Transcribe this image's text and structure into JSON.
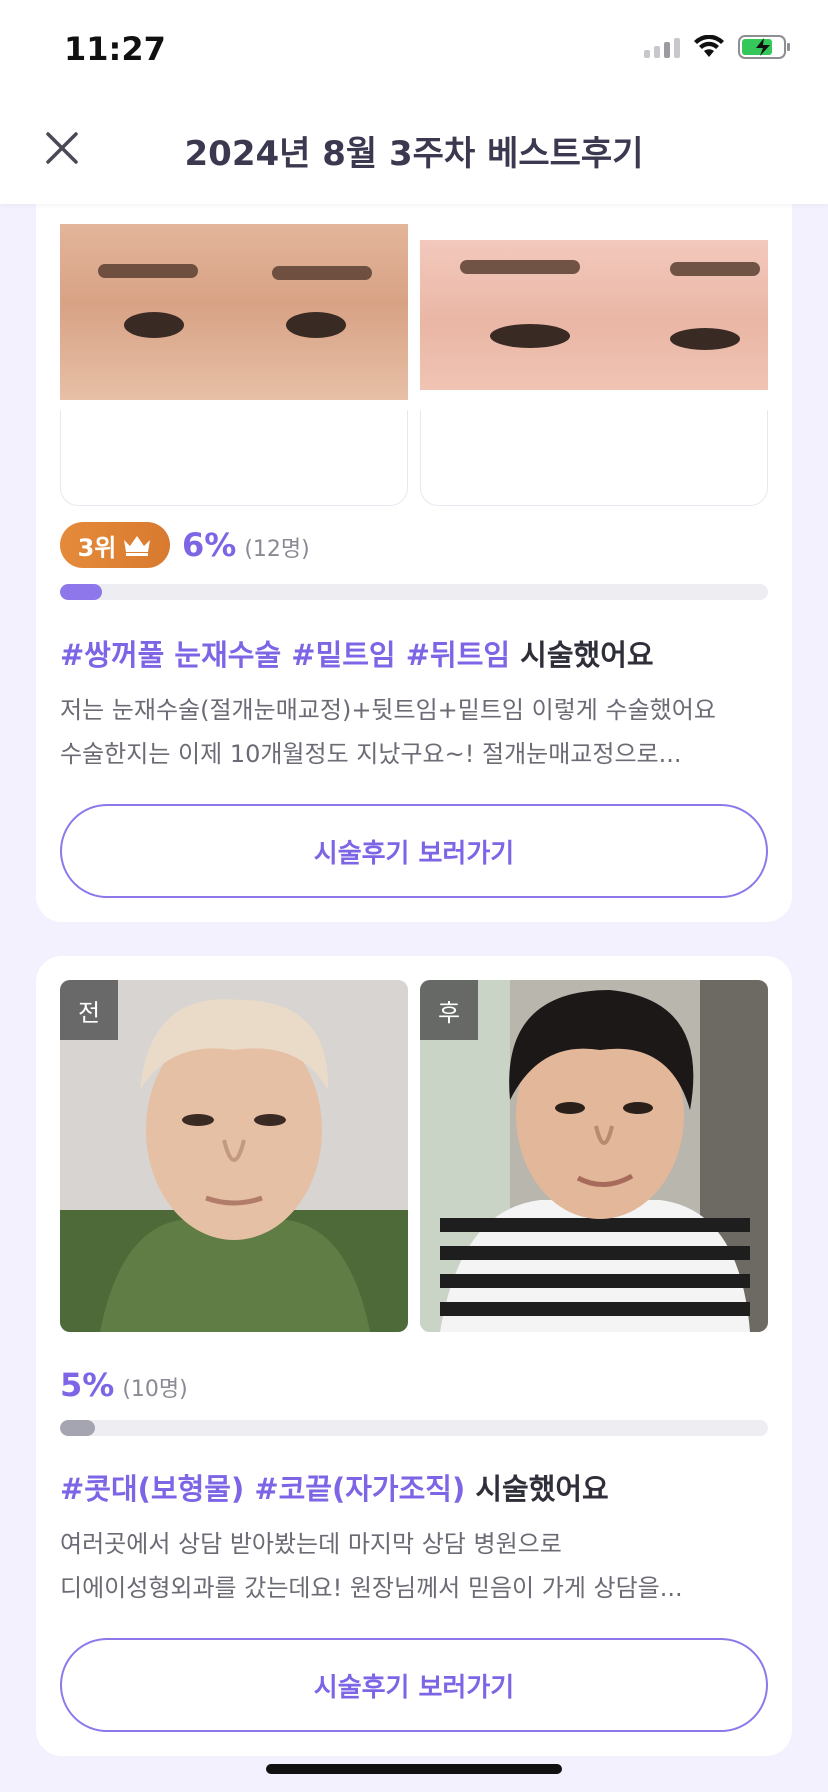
{
  "status_bar": {
    "time": "11:27"
  },
  "header": {
    "title": "2024년 8월 3주차 베스트후기"
  },
  "reviews": [
    {
      "rank_label": "3위",
      "percent": "6%",
      "count": "(12명)",
      "progress_value": 0.06,
      "tags": [
        "#쌍꺼풀 눈재수술",
        "#밑트임",
        "#뒤트임"
      ],
      "suffix": "시술했어요",
      "desc_lines": [
        "저는 눈재수술(절개눈매교정)+뒷트임+밑트임 이렇게 수술했어요",
        "수술한지는 이제 10개월정도 지났구요~! 절개눈매교정으로..."
      ],
      "button_label": "시술후기 보러가기"
    },
    {
      "before_label": "전",
      "after_label": "후",
      "percent": "5%",
      "count": "(10명)",
      "progress_value": 0.05,
      "tags": [
        "#콧대(보형물)",
        "#코끝(자가조직)"
      ],
      "suffix": "시술했어요",
      "desc_lines": [
        "여러곳에서 상담 받아봤는데 마지막 상담 병원으로",
        "디에이성형외과를 갔는데요! 원장님께서 믿음이 가게 상담을..."
      ],
      "button_label": "시술후기 보러가기"
    }
  ],
  "colors": {
    "accent": "#7d65e6",
    "rank_badge": "#e58a3a",
    "background": "#f3f1fd"
  }
}
